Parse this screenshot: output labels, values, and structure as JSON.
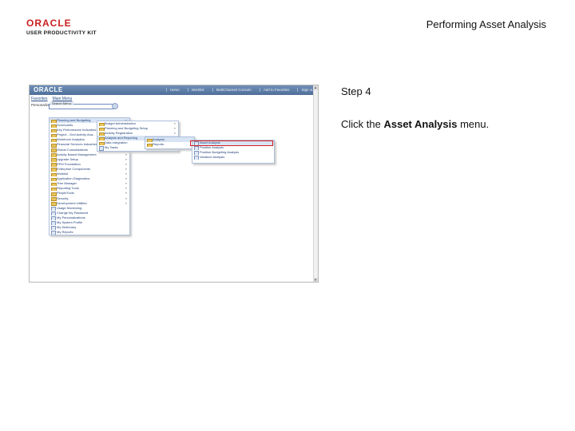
{
  "header": {
    "logo_word": "ORACLE",
    "logo_sub": "USER PRODUCTIVITY KIT",
    "title": "Performing Asset Analysis"
  },
  "step": {
    "label": "Step 4",
    "instruction_prefix": "Click the ",
    "instruction_bold": "Asset Analysis",
    "instruction_suffix": " menu."
  },
  "screenshot": {
    "logo": "ORACLE",
    "nav": [
      "Home",
      "Worklist",
      "MultiChannel Console",
      "Add to Favorites",
      "Sign out"
    ],
    "tabs": [
      "Favorites",
      "Main Menu"
    ],
    "personalize": "Personalize",
    "search_label": "Search Menu:",
    "menu_main": [
      {
        "label": "Planning and Budgeting",
        "type": "folder",
        "arrow": true,
        "highlight": true
      },
      {
        "label": "Scorecards",
        "type": "folder",
        "arrow": true
      },
      {
        "label": "Key Performance Indicators",
        "type": "folder",
        "arrow": true
      },
      {
        "label": "Project - Grid Activity Ana...",
        "type": "folder",
        "arrow": true
      },
      {
        "label": "Workforce Analytics",
        "type": "folder",
        "arrow": true
      },
      {
        "label": "Financial Services Industries",
        "type": "folder",
        "arrow": true
      },
      {
        "label": "Global Consolidations",
        "type": "folder",
        "arrow": true
      },
      {
        "label": "Activity Based Management",
        "type": "folder",
        "arrow": true
      },
      {
        "label": "Upgrade Setup",
        "type": "folder",
        "arrow": true
      },
      {
        "label": "EPM Foundation",
        "type": "folder",
        "arrow": true
      },
      {
        "label": "Enterprise Components",
        "type": "folder",
        "arrow": true
      },
      {
        "label": "Worklist",
        "type": "folder",
        "arrow": true
      },
      {
        "label": "Application Diagnostics",
        "type": "folder",
        "arrow": true
      },
      {
        "label": "Tree Manager",
        "type": "folder",
        "arrow": true
      },
      {
        "label": "Reporting Tools",
        "type": "folder",
        "arrow": true
      },
      {
        "label": "PeopleTools",
        "type": "folder",
        "arrow": true
      },
      {
        "label": "Security",
        "type": "folder",
        "arrow": true
      },
      {
        "label": "Development Utilities",
        "type": "folder",
        "arrow": true
      },
      {
        "label": "Usage Monitoring",
        "type": "doc",
        "arrow": false
      },
      {
        "label": "Change My Password",
        "type": "doc",
        "arrow": false
      },
      {
        "label": "My Personalizations",
        "type": "doc",
        "arrow": false
      },
      {
        "label": "My System Profile",
        "type": "doc",
        "arrow": false
      },
      {
        "label": "My Dictionary",
        "type": "doc",
        "arrow": false
      },
      {
        "label": "My Reports",
        "type": "doc",
        "arrow": false
      }
    ],
    "menu_sub": [
      {
        "label": "Budget Administration",
        "type": "folder",
        "arrow": true
      },
      {
        "label": "Planning and Budgeting Setup",
        "type": "folder",
        "arrow": true
      },
      {
        "label": "Activity Registration",
        "type": "folder",
        "arrow": true
      },
      {
        "label": "Analysis and Reporting",
        "type": "folder",
        "arrow": true,
        "highlight": true
      },
      {
        "label": "Data Integration",
        "type": "folder",
        "arrow": true
      },
      {
        "label": "My Tasks",
        "type": "doc",
        "arrow": false
      }
    ],
    "menu_analysis": [
      {
        "label": "Analysis",
        "type": "folder",
        "arrow": false,
        "highlight": true
      },
      {
        "label": "Reports",
        "type": "folder",
        "arrow": false
      }
    ],
    "menu_items": [
      {
        "label": "Asset Analysis",
        "type": "doc",
        "highlight": true
      },
      {
        "label": "Position Analysis",
        "type": "doc"
      },
      {
        "label": "Position Budgeting Analysis",
        "type": "doc"
      },
      {
        "label": "Variance Analysis",
        "type": "doc"
      }
    ],
    "colors": {
      "header": "#4f6f99",
      "highlight": "#d52020",
      "folder": "#e8c45a"
    }
  }
}
